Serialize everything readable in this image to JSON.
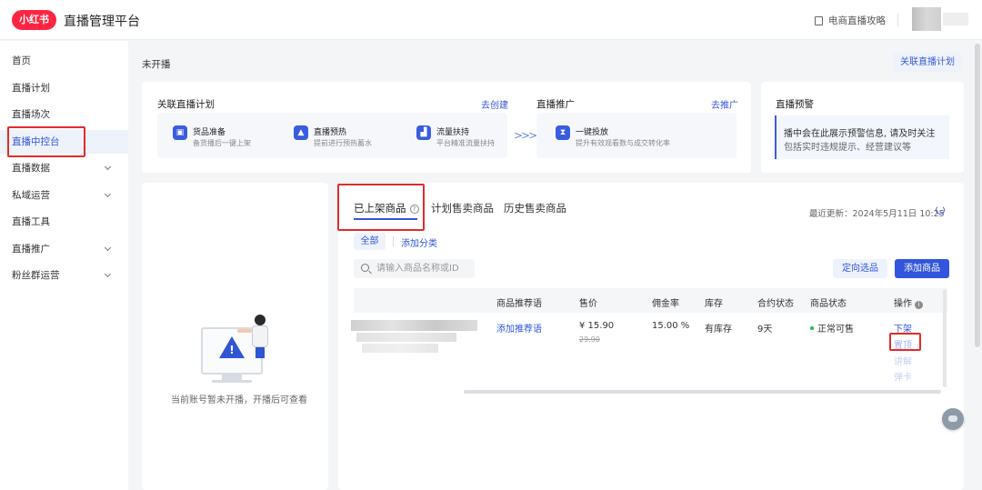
{
  "header": {
    "logo_text": "小红书",
    "platform_title": "直播管理平台",
    "guide_link": "电商直播攻略"
  },
  "sidebar": {
    "items": [
      {
        "label": "首页",
        "has_chevron": false
      },
      {
        "label": "直播计划",
        "has_chevron": false
      },
      {
        "label": "直播场次",
        "has_chevron": false
      },
      {
        "label": "直播中控台",
        "has_chevron": false,
        "active": true
      },
      {
        "label": "直播数据",
        "has_chevron": true
      },
      {
        "label": "私域运营",
        "has_chevron": true
      },
      {
        "label": "直播工具",
        "has_chevron": false
      },
      {
        "label": "直播推广",
        "has_chevron": true
      },
      {
        "label": "粉丝群运营",
        "has_chevron": true
      }
    ]
  },
  "main": {
    "status": "未开播",
    "link_plan_button": "关联直播计划",
    "plan_card": {
      "title": "关联直播计划",
      "create_link": "去创建",
      "steps": [
        {
          "icon": "bag-icon",
          "title": "货品准备",
          "desc": "备货播后一键上架"
        },
        {
          "icon": "flame-icon",
          "title": "直播预热",
          "desc": "提前进行预热蓄水"
        },
        {
          "icon": "chart-up-icon",
          "title": "流量扶持",
          "desc": "平台精准流量扶持"
        }
      ]
    },
    "promo_card": {
      "title": "直播推广",
      "link": "去推广",
      "step": {
        "icon": "hourglass-icon",
        "title": "一键投放",
        "desc": "提升有效观看数与成交转化率"
      }
    },
    "alert_card": {
      "title": "直播预警",
      "line1": "播中会在此展示预警信息, 请及时关注",
      "line2": "包括实时违规提示、经营建议等"
    },
    "empty_card": {
      "text": "当前账号暂未开播，开播后可查看"
    },
    "goods": {
      "tabs": [
        "已上架商品",
        "计划售卖商品",
        "历史售卖商品"
      ],
      "active_tab": 0,
      "last_update_label": "最近更新：2024年5月11日 10:25",
      "filter_all": "全部",
      "filter_add": "添加分类",
      "search_placeholder": "请输入商品名称或ID",
      "btn_select": "定向选品",
      "btn_add": "添加商品",
      "columns": [
        "商品推荐语",
        "售价",
        "佣金率",
        "库存",
        "合约状态",
        "商品状态",
        "操作"
      ],
      "rows": [
        {
          "recommend": "添加推荐语",
          "price": "¥ 15.90",
          "original_price": "29.90",
          "commission": "15.00 %",
          "stock": "有库存",
          "contract": "9天",
          "status": "正常可售",
          "actions": [
            "下架",
            "置顶",
            "讲解",
            "弹卡"
          ]
        }
      ]
    }
  },
  "colors": {
    "brand_red": "#ff2442",
    "accent_blue": "#3355dd",
    "highlight_red": "#e22b2b",
    "status_green": "#22b55f"
  }
}
